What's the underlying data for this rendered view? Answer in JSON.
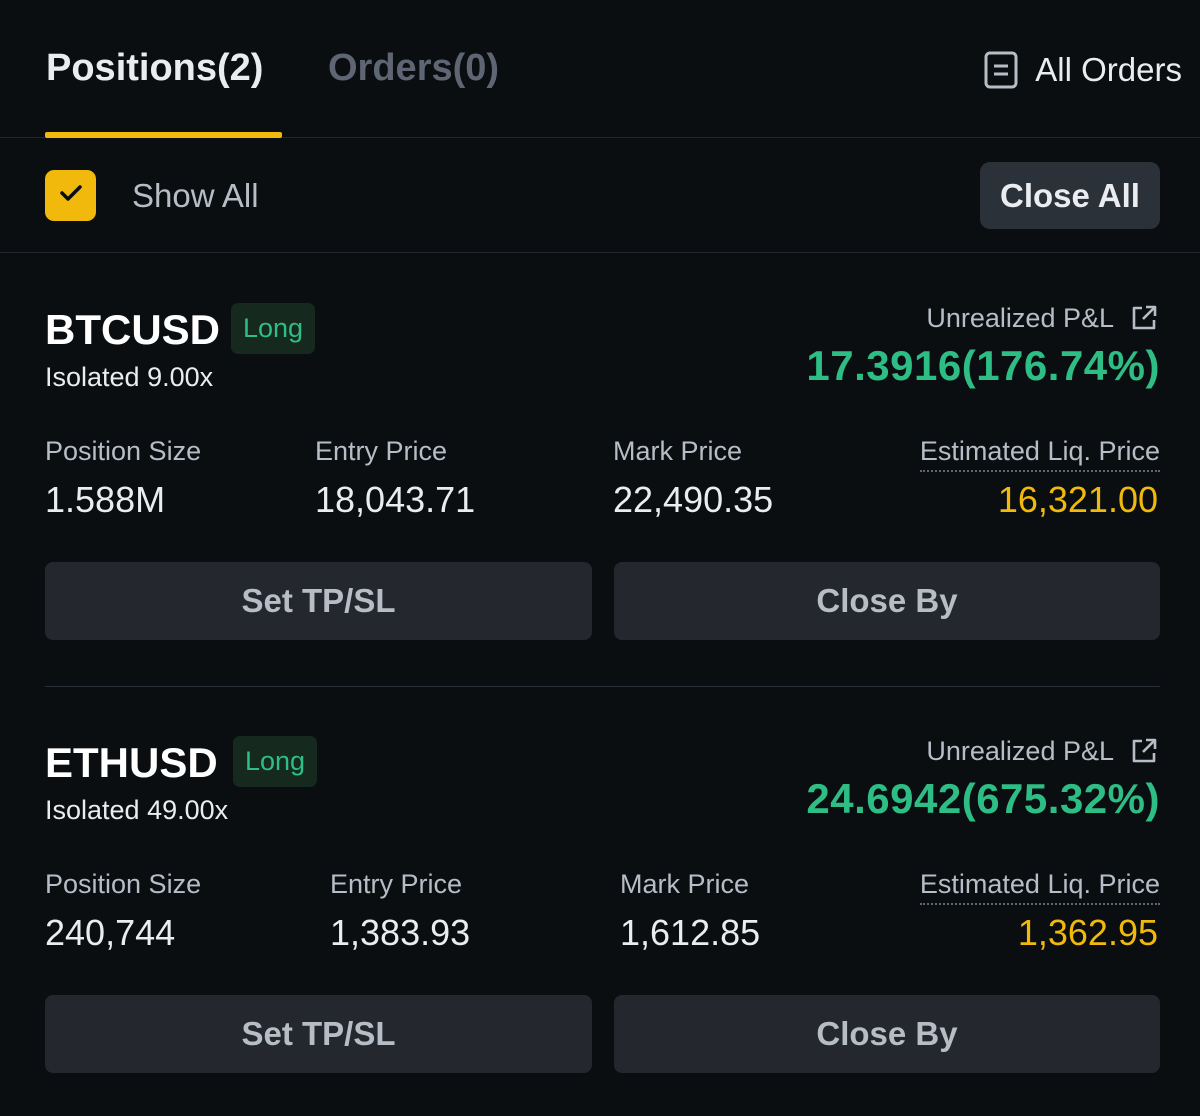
{
  "tabs": {
    "positions": "Positions(2)",
    "orders": "Orders(0)"
  },
  "header": {
    "all_orders_label": "All Orders",
    "all_orders_icon": "document-list-icon"
  },
  "filter": {
    "show_all_label": "Show All",
    "show_all_checked": true,
    "close_all_label": "Close All"
  },
  "colors": {
    "accent": "#f0b90b",
    "profit": "#2ebd85",
    "background": "#0b0e11"
  },
  "positions": [
    {
      "symbol": "BTCUSD",
      "side": "Long",
      "margin_mode": "Isolated 9.00x",
      "pnl_label": "Unrealized P&L",
      "pnl_value": "17.3916(176.74%)",
      "size_label": "Position Size",
      "size_value": "1.588M",
      "entry_label": "Entry Price",
      "entry_value": "18,043.71",
      "mark_label": "Mark Price",
      "mark_value": "22,490.35",
      "liq_label": "Estimated Liq. Price",
      "liq_value": "16,321.00",
      "tpsl_label": "Set TP/SL",
      "close_by_label": "Close By"
    },
    {
      "symbol": "ETHUSD",
      "side": "Long",
      "margin_mode": "Isolated 49.00x",
      "pnl_label": "Unrealized P&L",
      "pnl_value": "24.6942(675.32%)",
      "size_label": "Position Size",
      "size_value": "240,744",
      "entry_label": "Entry Price",
      "entry_value": "1,383.93",
      "mark_label": "Mark Price",
      "mark_value": "1,612.85",
      "liq_label": "Estimated Liq. Price",
      "liq_value": "1,362.95",
      "tpsl_label": "Set TP/SL",
      "close_by_label": "Close By"
    }
  ]
}
